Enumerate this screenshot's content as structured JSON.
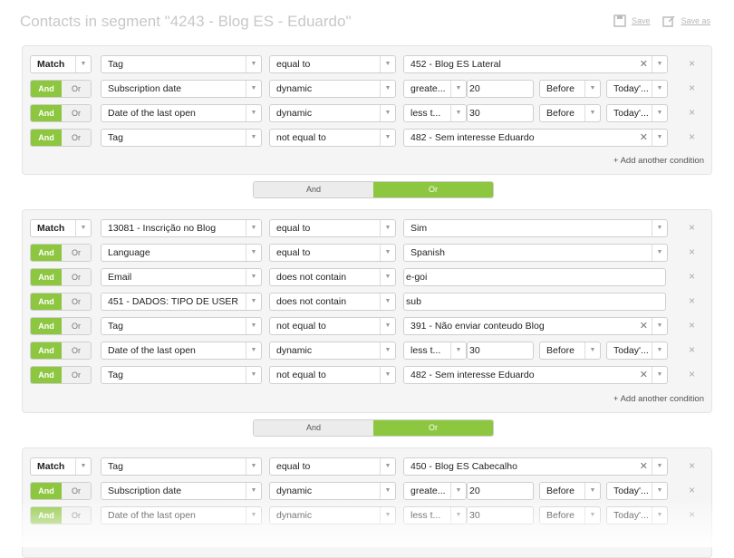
{
  "header": {
    "title": "Contacts in segment \"4243 - Blog ES - Eduardo\"",
    "save_label": "Save",
    "save_as_label": "Save as"
  },
  "ui": {
    "match": "Match",
    "and": "And",
    "or": "Or",
    "add_condition": "+ Add another condition",
    "remove": "×"
  },
  "blocks": [
    {
      "rows": [
        {
          "field": "Tag",
          "operator": "equal to",
          "value": "452 - Blog ES Lateral"
        },
        {
          "field": "Subscription date",
          "operator": "dynamic",
          "cmp": "greate...",
          "num": "20",
          "when": "Before",
          "ref": "Today'..."
        },
        {
          "field": "Date of the last open",
          "operator": "dynamic",
          "cmp": "less t...",
          "num": "30",
          "when": "Before",
          "ref": "Today'..."
        },
        {
          "field": "Tag",
          "operator": "not equal to",
          "value": "482 - Sem interesse Eduardo"
        }
      ]
    },
    {
      "rows": [
        {
          "field": "13081 - Inscrição no Blog",
          "operator": "equal to",
          "value": "Sim"
        },
        {
          "field": "Language",
          "operator": "equal to",
          "value": "Spanish"
        },
        {
          "field": "Email",
          "operator": "does not contain",
          "value": "e-goi"
        },
        {
          "field": "451 - DADOS: TIPO DE USER",
          "operator": "does not contain",
          "value": "sub"
        },
        {
          "field": "Tag",
          "operator": "not equal to",
          "value": "391 - Não enviar conteudo Blog"
        },
        {
          "field": "Date of the last open",
          "operator": "dynamic",
          "cmp": "less t...",
          "num": "30",
          "when": "Before",
          "ref": "Today'..."
        },
        {
          "field": "Tag",
          "operator": "not equal to",
          "value": "482 - Sem interesse Eduardo"
        }
      ]
    },
    {
      "rows": [
        {
          "field": "Tag",
          "operator": "equal to",
          "value": "450 - Blog ES Cabecalho"
        },
        {
          "field": "Subscription date",
          "operator": "dynamic",
          "cmp": "greate...",
          "num": "20",
          "when": "Before",
          "ref": "Today'..."
        },
        {
          "field": "Date of the last open",
          "operator": "dynamic",
          "cmp": "less t...",
          "num": "30",
          "when": "Before",
          "ref": "Today'..."
        }
      ]
    }
  ],
  "colors": {
    "accent": "#8dc63f",
    "title": "#c8c8c8"
  }
}
